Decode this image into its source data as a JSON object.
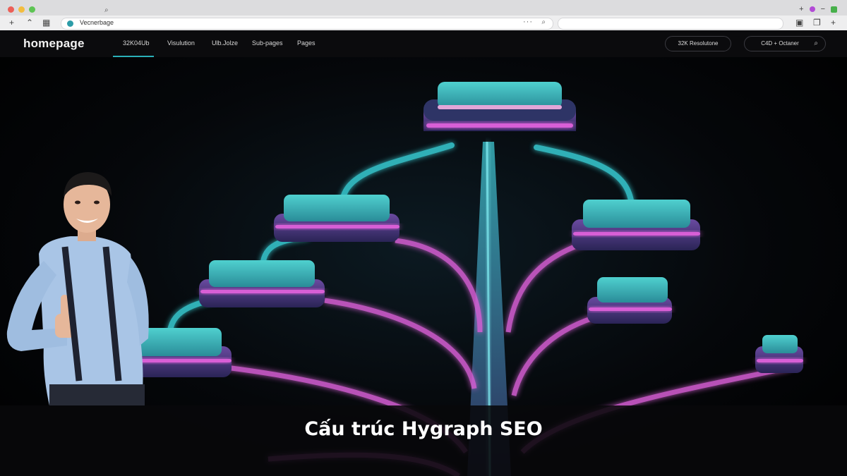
{
  "browser": {
    "address_text": "Vecnerbage"
  },
  "nav": {
    "logo": "homepage",
    "links": [
      "32K04Ub",
      "Visulution",
      "Ulb.Jolze",
      "Sub-pages",
      "Pages"
    ],
    "resolution_pill": "32K Resolutone",
    "engine_pill": "C4D + Octaner"
  },
  "caption": "Cấu trúc Hygraph SEO",
  "colors": {
    "accent_teal": "#2ab0b8",
    "neon_pink": "#d85fd6",
    "background": "#000000"
  },
  "icons": [
    "search-icon",
    "plus-icon",
    "share-icon",
    "sidebar-icon",
    "globe-icon",
    "more-icon",
    "tabs-icon",
    "copy-icon",
    "add-tab-icon"
  ]
}
